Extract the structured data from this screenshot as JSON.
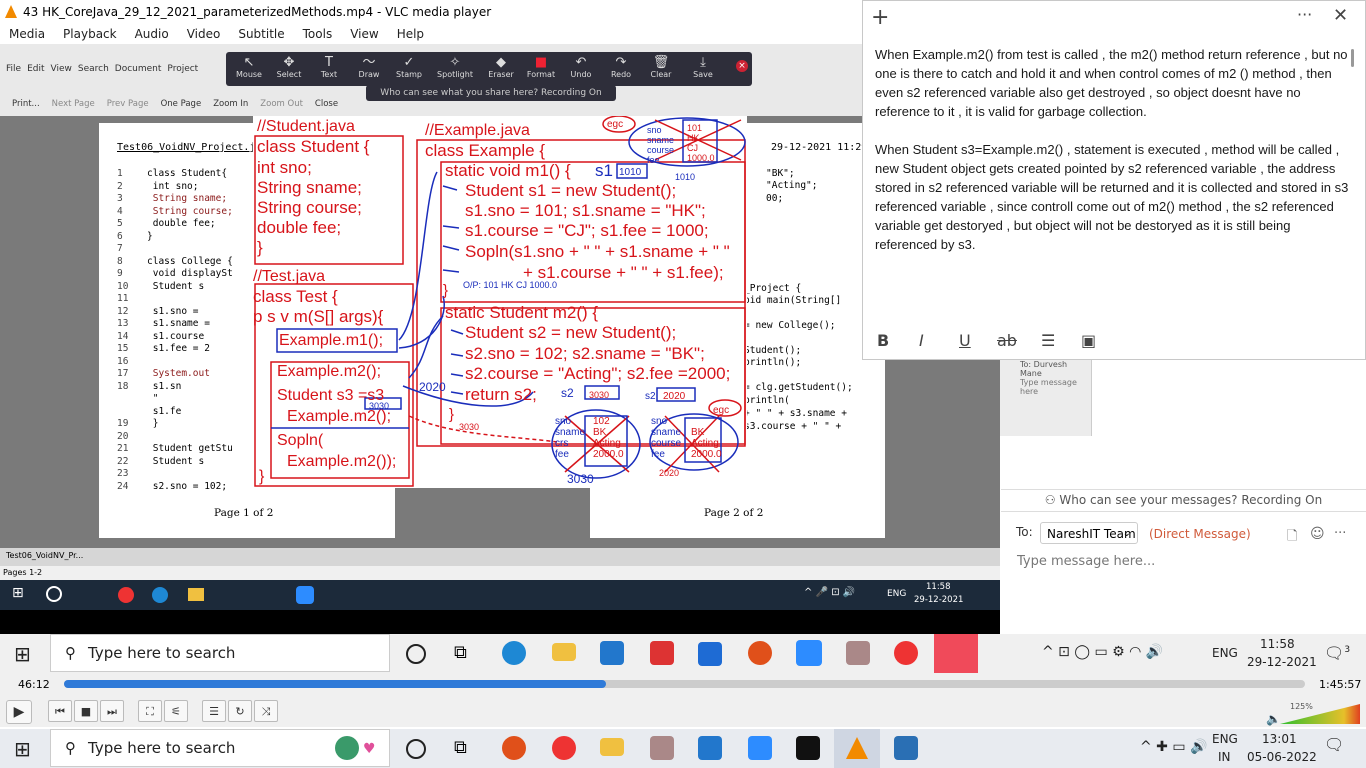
{
  "vlc": {
    "title": "43 HK_CoreJava_29_12_2021_parameterizedMethods.mp4 - VLC media player",
    "menu": [
      "Media",
      "Playback",
      "Audio",
      "Video",
      "Subtitle",
      "Tools",
      "View",
      "Help"
    ],
    "time_current": "46:12",
    "time_total": "1:45:57",
    "progress_fraction": 0.437,
    "volume": "125%"
  },
  "zoom_toolbar": {
    "tools": [
      {
        "label": "Mouse",
        "icon": "cursor-icon"
      },
      {
        "label": "Select",
        "icon": "select-icon"
      },
      {
        "label": "Text",
        "icon": "text-icon"
      },
      {
        "label": "Draw",
        "icon": "draw-icon"
      },
      {
        "label": "Stamp",
        "icon": "stamp-icon"
      },
      {
        "label": "Spotlight",
        "icon": "spotlight-icon"
      },
      {
        "label": "Eraser",
        "icon": "eraser-icon"
      },
      {
        "label": "Format",
        "icon": "format-icon"
      },
      {
        "label": "Undo",
        "icon": "undo-icon"
      },
      {
        "label": "Redo",
        "icon": "redo-icon"
      },
      {
        "label": "Clear",
        "icon": "trash-icon"
      },
      {
        "label": "Save",
        "icon": "save-icon"
      }
    ],
    "banner": "Who can see what you share here? Recording On"
  },
  "ppt": {
    "menu": [
      "File",
      "Edit",
      "View",
      "Search",
      "Document",
      "Project"
    ],
    "nav": [
      "Print...",
      "Next Page",
      "Prev Page",
      "One Page",
      "Zoom In",
      "Zoom Out",
      "Close"
    ],
    "page1_title": "Test06_VoidNV_Project.j",
    "page2_title": "29-12-2021 11:29",
    "page1_footer": "Page 1 of 2",
    "page2_footer": "Page 2 of 2",
    "pages_count": "Pages 1-2",
    "tab": "Test06_VoidNV_Pr..."
  },
  "code_page1": [
    {
      "n": "1",
      "t": "class Student{"
    },
    {
      "n": "2",
      "t": "    int sno;"
    },
    {
      "n": "3",
      "t": "    String sname;"
    },
    {
      "n": "4",
      "t": "    String course;"
    },
    {
      "n": "5",
      "t": "    double fee;"
    },
    {
      "n": "6",
      "t": "}"
    },
    {
      "n": "7",
      "t": ""
    },
    {
      "n": "8",
      "t": "class College {"
    },
    {
      "n": "9",
      "t": "    void displaySt"
    },
    {
      "n": "10",
      "t": "        Student s"
    },
    {
      "n": "11",
      "t": ""
    },
    {
      "n": "12",
      "t": "        s1.sno ="
    },
    {
      "n": "13",
      "t": "        s1.sname ="
    },
    {
      "n": "14",
      "t": "        s1.course"
    },
    {
      "n": "15",
      "t": "        s1.fee = 2"
    },
    {
      "n": "16",
      "t": ""
    },
    {
      "n": "17",
      "t": "        System.out"
    },
    {
      "n": "18",
      "t": "          s1.sn"
    },
    {
      "n": "",
      "t": "          \"  "
    },
    {
      "n": "",
      "t": "          s1.fe"
    },
    {
      "n": "19",
      "t": "    }"
    },
    {
      "n": "20",
      "t": ""
    },
    {
      "n": "21",
      "t": "    Student getStu"
    },
    {
      "n": "22",
      "t": "        Student s"
    },
    {
      "n": "23",
      "t": ""
    },
    {
      "n": "24",
      "t": "        s2.sno = 102;"
    }
  ],
  "code_page2": [
    {
      "t": "\"BK\";"
    },
    {
      "t": "\"Acting\";"
    },
    {
      "t": "00;"
    },
    {
      "t": "_Project {"
    },
    {
      "t": "oid main(String[]"
    },
    {
      "t": "= new College();"
    },
    {
      "t": "Student();"
    },
    {
      "t": "println();"
    },
    {
      "t": "= clg.getStudent();"
    },
    {
      "t": "println("
    },
    {
      "t": "+ \"  \" + s3.sname +"
    },
    {
      "t": "s3.course + \"  \" +"
    }
  ],
  "board": {
    "student_file": "//Student.java",
    "student_code": [
      "class Student {",
      "  int      sno;",
      "  String sname;",
      "  String course;",
      "  double fee;",
      "}"
    ],
    "test_file": "//Test.java",
    "test_code": [
      "class Test {",
      "  p s v m(S[] args){"
    ],
    "call_m1": "Example.m1();",
    "call_m2": "Example.m2();",
    "s3_line1": "Student s3 =s3",
    "s3_line2": "Example.m2();",
    "sopln1": "Sopln(",
    "sopln2": "Example.m2());",
    "brace_close": "}",
    "example_file": "//Example.java",
    "example_class": "class Example {",
    "m1_code": [
      "static  void   m1() {",
      "Student s1 = new Student();",
      "s1.sno = 101; s1.sname = \"HK\";",
      "s1.course = \"CJ\"; s1.fee = 1000;",
      "Sopln(s1.sno + \" \" + s1.sname + \" \"",
      "+ s1.course + \"  \" + s1.fee);",
      "}"
    ],
    "m1_s1": "s1",
    "m1_addr": "1010",
    "m1_op": "O/P: 101  HK  CJ  1000.0",
    "m2_code": [
      "static Student m2() {",
      "Student s2 = new Student();",
      "s2.sno = 102; s2.sname = \"BK\";",
      "s2.course = \"Acting\"; s2.fee =2000;",
      "return s2;",
      "}"
    ],
    "egc": "egc",
    "obj1": {
      "labels": [
        "sno",
        "sname",
        "course",
        "fee"
      ],
      "vals": [
        "101",
        "HK",
        "CJ",
        "1000.0"
      ],
      "addr": "1010"
    },
    "obj2": {
      "labels": [
        "sno",
        "sname",
        "crs",
        "fee"
      ],
      "vals": [
        "102",
        "BK",
        "Acting",
        "2000.0"
      ],
      "addr": "3030"
    },
    "obj3": {
      "labels": [
        "sno",
        "sname",
        "course",
        "fee"
      ],
      "vals": [
        "",
        "BK",
        "Acting",
        "2000.0"
      ],
      "addr": "2020"
    },
    "s2_lbl_a": "s2",
    "s2_addr_a": "3030",
    "s2_lbl_b": "s2",
    "s2_addr_b": "2020",
    "s3_addr": "3030",
    "addr_2020": "2020",
    "addr_3030": "3030"
  },
  "note": {
    "para1": "When Example.m2() from test is called , the m2() method return reference , but no one is there to catch and hold it and when control comes of m2 () method , then even s2 referenced variable also get destroyed , so object doesnt have no reference to it , it is valid for garbage collection.",
    "para2": " When Student s3=Example.m2() , statement is executed , method will be called , new Student object gets created pointed by s2  referenced variable  , the address stored in s2 referenced variable will be returned and it is collected and stored in s3 referenced variable , since controll come out of m2() method , the s2 referenced variable get destoryed  , but object will not be destoryed as it is still being referenced by s3."
  },
  "chat": {
    "recording": "Who can see your messages? Recording On",
    "to_label": "To:",
    "recipient": "NareshIT Team",
    "dm": "(Direct Message)",
    "placeholder": "Type message here...",
    "under_to": "To:",
    "under_name": "Durvesh Mane",
    "under_placeholder": "Type message here"
  },
  "inner_taskbar": {
    "lang": "ENG",
    "time": "11:58",
    "date": "29-12-2021"
  },
  "taskbar1": {
    "search": "Type here to search",
    "lang": "ENG",
    "time": "11:58",
    "date": "29-12-2021",
    "notif": "3"
  },
  "taskbar2": {
    "search": "Type here to search",
    "lang1": "ENG",
    "lang2": "IN",
    "time": "13:01",
    "date": "05-06-2022"
  }
}
